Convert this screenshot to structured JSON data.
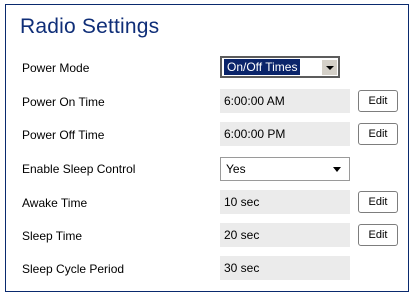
{
  "title": "Radio Settings",
  "rows": {
    "power_mode": {
      "label": "Power Mode",
      "value": "On/Off Times"
    },
    "power_on_time": {
      "label": "Power On Time",
      "value": "6:00:00 AM",
      "edit": "Edit"
    },
    "power_off_time": {
      "label": "Power Off Time",
      "value": "6:00:00 PM",
      "edit": "Edit"
    },
    "enable_sleep_control": {
      "label": "Enable Sleep Control",
      "value": "Yes"
    },
    "awake_time": {
      "label": "Awake Time",
      "value": "10 sec",
      "edit": "Edit"
    },
    "sleep_time": {
      "label": "Sleep Time",
      "value": "20 sec",
      "edit": "Edit"
    },
    "sleep_cycle_period": {
      "label": "Sleep Cycle Period",
      "value": "30 sec"
    }
  },
  "colors": {
    "title": "#0f2e78",
    "border": "#0a2a6e",
    "readonly_bg": "#ebebeb",
    "selection_bg": "#0a246a"
  },
  "icons": {
    "dropdown_arrow": "chevron-down-icon"
  }
}
